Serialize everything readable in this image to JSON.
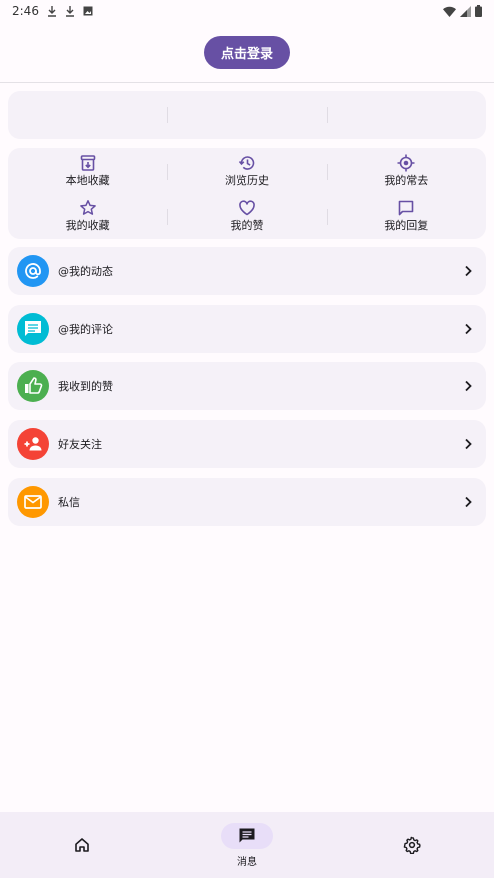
{
  "status_bar": {
    "time": "2:46"
  },
  "header": {
    "login_label": "点击登录"
  },
  "colors": {
    "primary": "#6750a4",
    "card_bg": "#f5f1f8",
    "mentions_blue": "#2196f3",
    "comments_cyan": "#00bcd4",
    "likes_green": "#4caf50",
    "friends_red": "#f44336",
    "messages_orange": "#ff9800"
  },
  "shortcuts": [
    {
      "label": "本地收藏",
      "icon": "archive-download-icon"
    },
    {
      "label": "浏览历史",
      "icon": "history-icon"
    },
    {
      "label": "我的常去",
      "icon": "target-icon"
    },
    {
      "label": "我的收藏",
      "icon": "star-icon"
    },
    {
      "label": "我的赞",
      "icon": "heart-icon"
    },
    {
      "label": "我的回复",
      "icon": "chat-bubble-icon"
    }
  ],
  "list": [
    {
      "label": "@我的动态",
      "icon": "at-sign-icon"
    },
    {
      "label": "@我的评论",
      "icon": "comment-icon"
    },
    {
      "label": "我收到的赞",
      "icon": "thumb-up-icon"
    },
    {
      "label": "好友关注",
      "icon": "person-add-icon"
    },
    {
      "label": "私信",
      "icon": "mail-icon"
    }
  ],
  "bottom_nav": {
    "home_icon": "home-icon",
    "messages_label": "消息",
    "settings_icon": "gear-icon"
  }
}
